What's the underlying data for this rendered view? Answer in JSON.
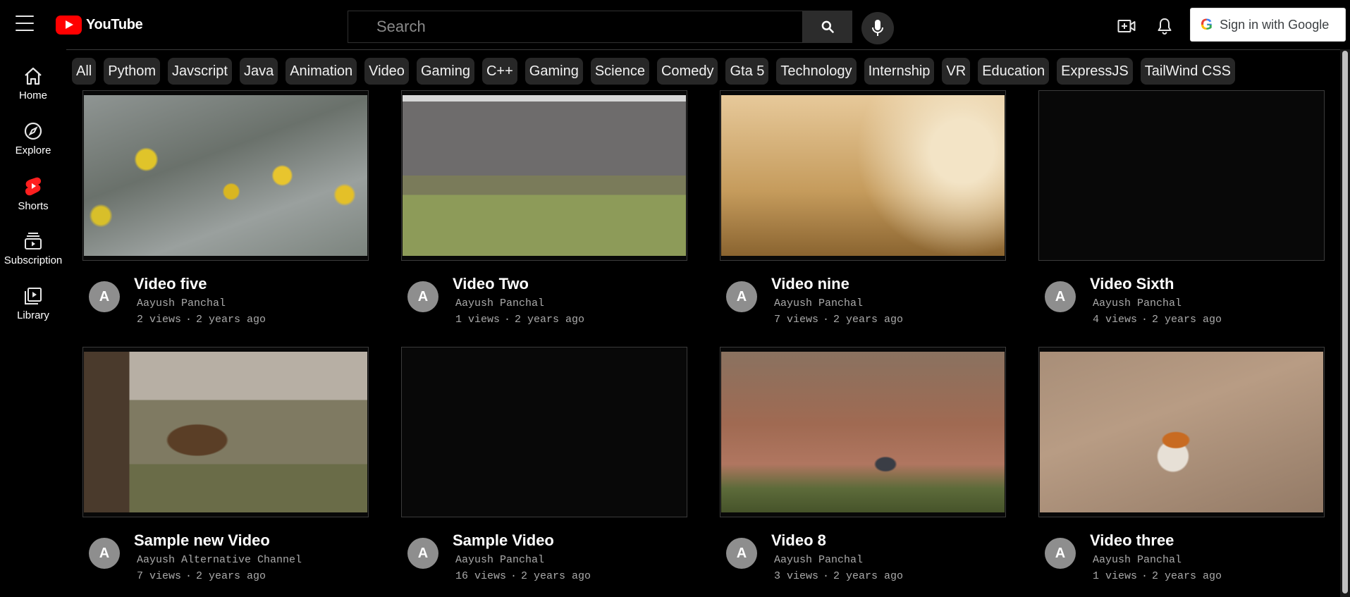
{
  "header": {
    "logo_text": "YouTube",
    "search_placeholder": "Search",
    "signin_label": "Sign in with Google",
    "google_g": "G"
  },
  "sidebar": {
    "items": [
      {
        "label": "Home",
        "icon": "home-icon"
      },
      {
        "label": "Explore",
        "icon": "compass-icon"
      },
      {
        "label": "Shorts",
        "icon": "shorts-icon"
      },
      {
        "label": "Subscription",
        "icon": "subscriptions-icon"
      },
      {
        "label": "Library",
        "icon": "library-icon"
      }
    ]
  },
  "chips": [
    "All",
    "Pythom",
    "Javscript",
    "Java",
    "Animation",
    "Video",
    "Gaming",
    "C++",
    "Gaming",
    "Science",
    "Comedy",
    "Gta 5",
    "Technology",
    "Internship",
    "VR",
    "Education",
    "ExpressJS",
    "TailWind CSS"
  ],
  "videos": [
    {
      "title": "Video five",
      "channel": "Aayush Panchal",
      "views": "2 views",
      "age": "2 years ago",
      "avatar": "A"
    },
    {
      "title": "Video Two",
      "channel": "Aayush Panchal",
      "views": "1 views",
      "age": "2 years ago",
      "avatar": "A"
    },
    {
      "title": "Video nine",
      "channel": "Aayush Panchal",
      "views": "7 views",
      "age": "2 years ago",
      "avatar": "A"
    },
    {
      "title": "Video Sixth",
      "channel": "Aayush Panchal",
      "views": "4 views",
      "age": "2 years ago",
      "avatar": "A"
    },
    {
      "title": "Sample new Video",
      "channel": "Aayush Alternative Channel",
      "views": "7 views",
      "age": "2 years ago",
      "avatar": "A"
    },
    {
      "title": "Sample Video",
      "channel": "Aayush Panchal",
      "views": "16 views",
      "age": "2 years ago",
      "avatar": "A"
    },
    {
      "title": "Video 8",
      "channel": "Aayush Panchal",
      "views": "3 views",
      "age": "2 years ago",
      "avatar": "A"
    },
    {
      "title": "Video three",
      "channel": "Aayush Panchal",
      "views": "1 views",
      "age": "2 years ago",
      "avatar": "A"
    }
  ],
  "separator": "·",
  "colors": {
    "accent": "#ff0000",
    "chip_bg": "#272727",
    "background": "#000000"
  }
}
